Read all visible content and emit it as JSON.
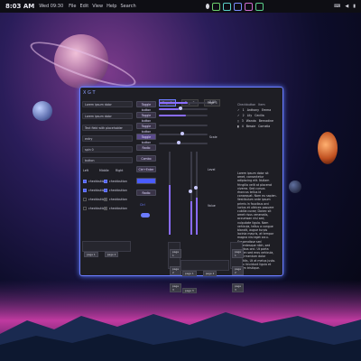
{
  "topbar": {
    "clock": "8:03 AM",
    "date": "Wed 09:30",
    "menu": [
      "File",
      "Edit",
      "View",
      "Help",
      "Search"
    ],
    "workspace_colors": [
      "#d8d8e0",
      "#6ccf6c",
      "#5ad0c8",
      "#7a8cff",
      "#cf6ccf",
      "#5acf8a"
    ],
    "tray": [
      "en",
      "vol",
      "bat"
    ]
  },
  "window": {
    "title": "X G T",
    "inputs": [
      {
        "value": "Lorem ipsum dolor"
      },
      {
        "value": "Lorem ipsum dolor"
      },
      {
        "value": "Text field with placeholder"
      },
      {
        "value": "entry"
      },
      {
        "value": "spin 0"
      },
      {
        "value": "button"
      }
    ],
    "buttons": [
      "Toggle button",
      "Toggle button",
      "Toggle button",
      "Toggle button",
      "Radio",
      "Combo",
      "Text",
      "Ctrl+Enter",
      "Radio"
    ],
    "radios": [
      "Left",
      "Middle",
      "Right"
    ],
    "checks": [
      "checkbutton",
      "checkbutton",
      "checkbutton",
      "checkbutton",
      "checkbutton",
      "checkbutton",
      "checkbutton",
      "checkbutton"
    ],
    "tabs": [
      "Page 1",
      "Page 2",
      "Page 3"
    ],
    "slider_label_top": "0.00",
    "slider_label_mid": "Scale",
    "slider_label_low": "Level",
    "slider_label_bottom": "Value",
    "list_header": [
      "Checkbutton",
      "Item",
      "Text"
    ],
    "list_rows": [
      {
        "icon": "check",
        "num": "1",
        "text": "Anthony",
        "val": "Emma"
      },
      {
        "icon": "check",
        "num": "2",
        "text": "Lily",
        "val": "Cecilia"
      },
      {
        "icon": "doc",
        "num": "3",
        "text": "Wanda",
        "val": "Bernadine"
      },
      {
        "icon": "doc",
        "num": "4",
        "text": "Bessie",
        "val": "Cornelia"
      }
    ],
    "paragraph": "Lorem ipsum dolor sit amet, consectetur adipiscing elit. Nullam fringilla velit at placerat viverra. Sed cursus rhoncus tellus id consequat. Nam eu sapien. Vestibulum ante ipsum primis in faucibus orci luctus et ultrices posuere cubilia curae; Donec sit amet risus venenatis, accumsan nisl sed, vulputate ligula. Nam vehicula, tellus a congue blandit, augue turpis lacinia mauris, at tempor magna nisl eget arcu. Suspendisse sed pellentesque nibh, sed dapibus orci. Ut porta sapien sed eros vehicula, ut fermentum dolor sagittis, Ut at metus justo. Nunc tincidunt ligula et ipsum tristique.",
    "footer": [
      "page 1",
      "page 2",
      "page 3"
    ],
    "progress": 0.6,
    "accent": "#6c7cff"
  }
}
